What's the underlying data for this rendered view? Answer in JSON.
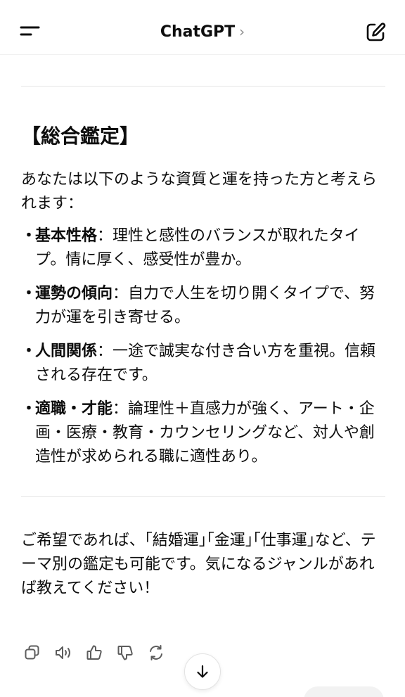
{
  "header": {
    "title": "ChatGPT",
    "chevron": "›",
    "menu_icon": "menu-icon",
    "compose_icon": "compose-icon"
  },
  "message": {
    "heading": "【総合鑑定】",
    "intro": "あなたは以下のような資質と運を持った方と考えられます：",
    "bullet_marker": "・",
    "items": [
      {
        "term": "基本性格",
        "text": "：理性と感性のバランスが取れたタイプ。情に厚く、感受性が豊か。"
      },
      {
        "term": "運勢の傾向",
        "text": "：自力で人生を切り開くタイプで、努力が運を引き寄せる。"
      },
      {
        "term": "人間関係",
        "text": "：一途で誠実な付き合い方を重視。信頼される存在です。"
      },
      {
        "term": "適職・才能",
        "text": "：論理性＋直感力が強く、アート・企画・医療・教育・カウンセリングなど、対人や創造性が求められる職に適性あり。"
      }
    ],
    "closing": "ご希望であれば、｢結婚運｣｢金運｣｢仕事運｣など、テーマ別の鑑定も可能です。気になるジャンルがあれば教えてください！"
  },
  "actions": [
    {
      "icon": "copy-icon"
    },
    {
      "icon": "speaker-icon"
    },
    {
      "icon": "thumbs-up-icon"
    },
    {
      "icon": "thumbs-down-icon"
    },
    {
      "icon": "regenerate-icon"
    }
  ],
  "scroll_down_icon": "arrow-down-icon",
  "colors": {
    "text": "#0d0d0d",
    "muted": "#8e8e8e",
    "divider": "#e6e6e6",
    "icon": "#5d5d5d"
  }
}
